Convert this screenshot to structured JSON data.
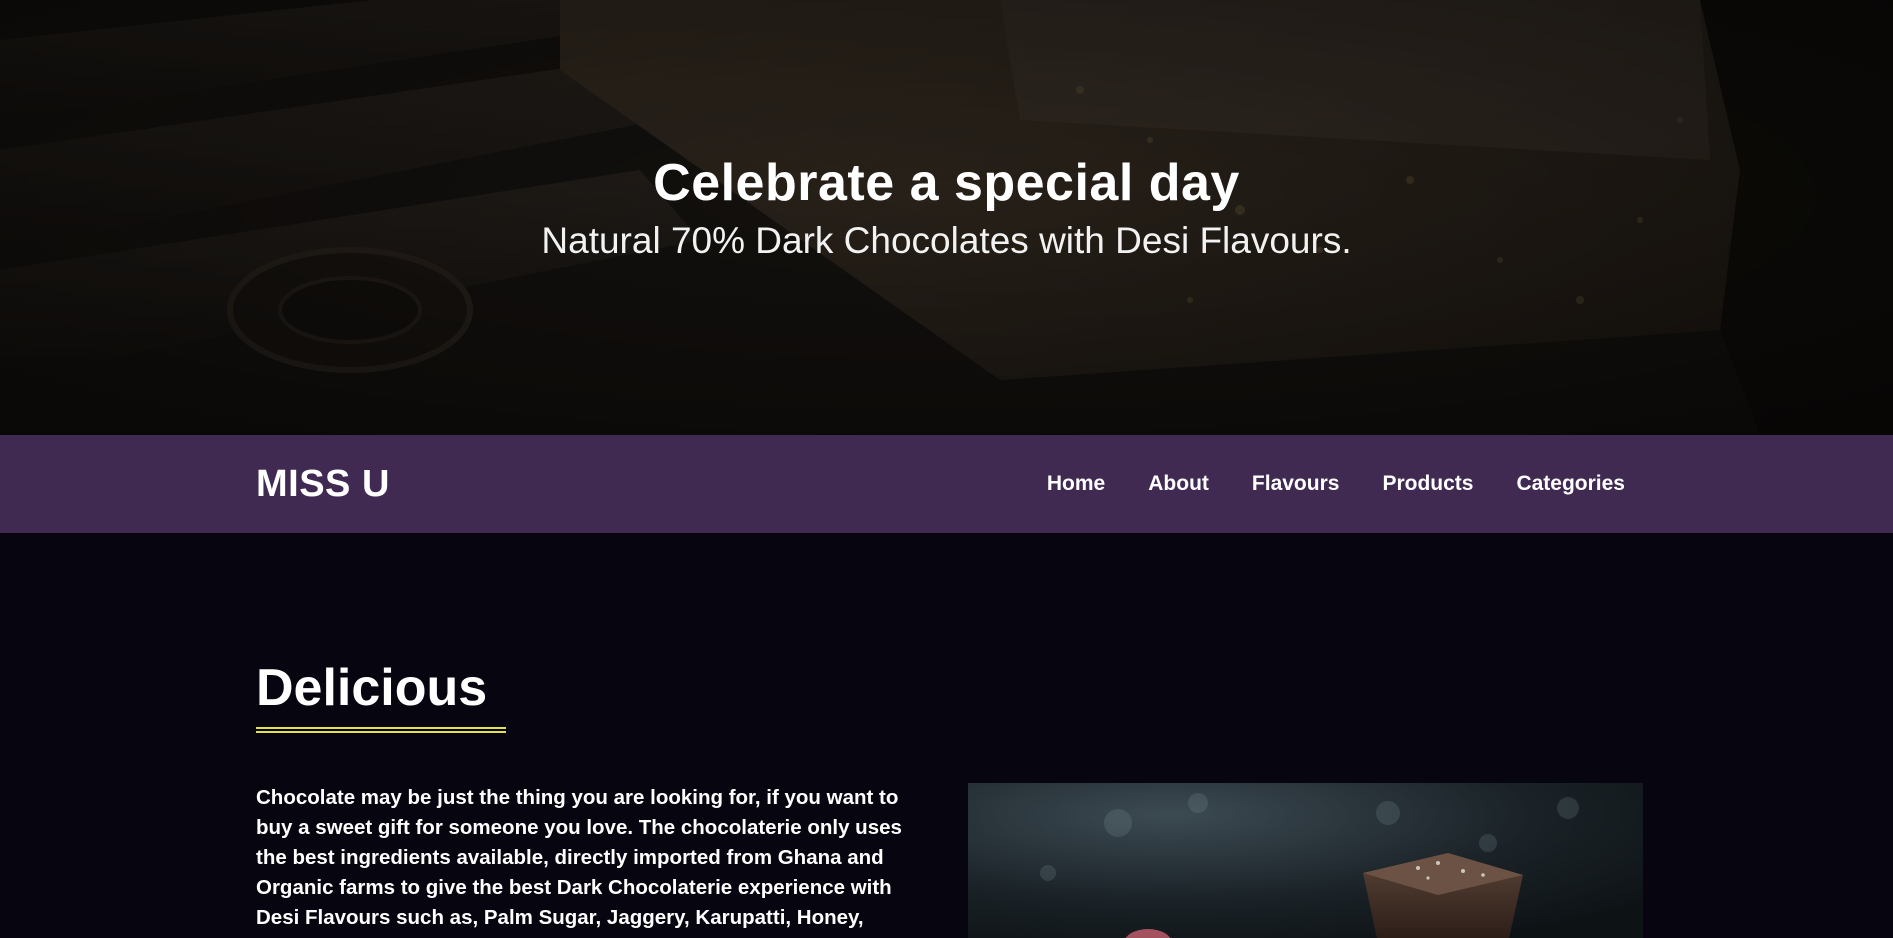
{
  "hero": {
    "title": "Celebrate a special day",
    "subtitle": "Natural 70% Dark Chocolates with Desi Flavours."
  },
  "navbar": {
    "brand": "MISS U",
    "links": [
      {
        "label": "Home"
      },
      {
        "label": "About"
      },
      {
        "label": "Flavours"
      },
      {
        "label": "Products"
      },
      {
        "label": "Categories"
      }
    ],
    "background": "#412a52"
  },
  "section": {
    "title": "Delicious",
    "underline_color": "#e2e24a",
    "body": "Chocolate may be just the thing you are looking for, if you want to buy a sweet gift for someone you love. The chocolaterie only uses the best ingredients available, directly imported from Ghana and Organic farms to give the best Dark Chocolaterie experience with Desi Flavours such as, Palm Sugar, Jaggery, Karupatti, Honey,"
  },
  "colors": {
    "page_background": "#07050f",
    "accent": "#e2e24a"
  }
}
